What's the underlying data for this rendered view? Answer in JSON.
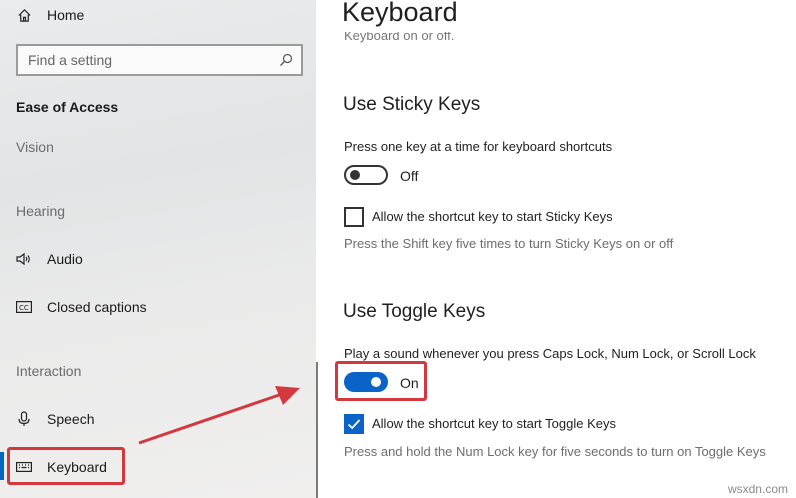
{
  "sidebar": {
    "home": "Home",
    "search_placeholder": "Find a setting",
    "category": "Ease of Access",
    "sections": {
      "vision": "Vision",
      "hearing": "Hearing",
      "interaction": "Interaction"
    },
    "items": {
      "audio": "Audio",
      "closed_captions": "Closed captions",
      "speech": "Speech",
      "keyboard": "Keyboard"
    },
    "selected": "Keyboard"
  },
  "main": {
    "title": "Keyboard",
    "cut_text": "Keyboard on or off.",
    "sticky": {
      "heading": "Use Sticky Keys",
      "desc": "Press one key at a time for keyboard shortcuts",
      "toggle_state": "Off",
      "checkbox_label": "Allow the shortcut key to start Sticky Keys",
      "checkbox_checked": false,
      "hint": "Press the Shift key five times to turn Sticky Keys on or off"
    },
    "toggle": {
      "heading": "Use Toggle Keys",
      "desc": "Play a sound whenever you press Caps Lock, Num Lock, or Scroll Lock",
      "toggle_state": "On",
      "checkbox_label": "Allow the shortcut key to start Toggle Keys",
      "checkbox_checked": true,
      "hint": "Press and hold the Num Lock key for five seconds to turn on Toggle Keys"
    }
  },
  "colors": {
    "accent": "#0a63c9",
    "highlight": "#d5373f"
  },
  "watermark": "wsxdn.com"
}
